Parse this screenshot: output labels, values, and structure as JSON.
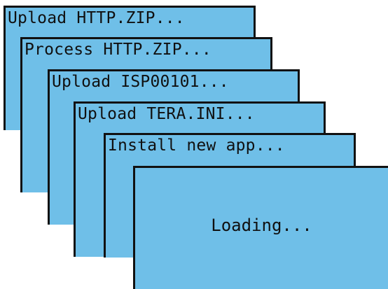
{
  "screens": [
    {
      "message": "Upload HTTP.ZIP..."
    },
    {
      "message": "Process HTTP.ZIP..."
    },
    {
      "message": "Upload ISP00101..."
    },
    {
      "message": "Upload TERA.INI..."
    },
    {
      "message": "Install new app..."
    },
    {
      "message": "Loading..."
    }
  ],
  "colors": {
    "screen_bg": "#6fbfe8",
    "border": "#111111",
    "text": "#101010"
  }
}
